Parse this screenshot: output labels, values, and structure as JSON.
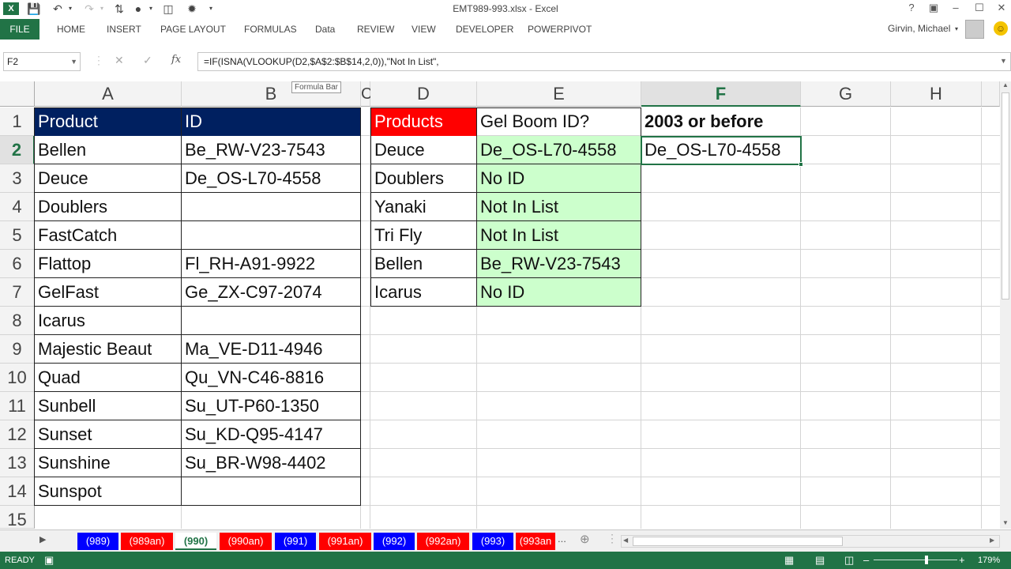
{
  "window": {
    "title": "EMT989-993.xlsx - Excel"
  },
  "ribbon": {
    "file": "FILE",
    "tabs": [
      "HOME",
      "INSERT",
      "PAGE LAYOUT",
      "FORMULAS",
      "Data",
      "REVIEW",
      "VIEW",
      "DEVELOPER",
      "POWERPIVOT"
    ],
    "user": "Girvin, Michael"
  },
  "formula_bar": {
    "name_box": "F2",
    "formula": "=IF(ISNA(VLOOKUP(D2,$A$2:$B$14,2,0)),\"Not In List\",",
    "tooltip": "Formula Bar",
    "fx": "fx"
  },
  "grid": {
    "columns": [
      "A",
      "B",
      "C",
      "D",
      "E",
      "F",
      "G",
      "H"
    ],
    "rows": [
      "1",
      "2",
      "3",
      "4",
      "5",
      "6",
      "7",
      "8",
      "9",
      "10",
      "11",
      "12",
      "13",
      "14",
      "15"
    ],
    "left_table": {
      "headers": [
        "Product",
        "ID"
      ],
      "rows": [
        [
          "Bellen",
          "Be_RW-V23-7543"
        ],
        [
          "Deuce",
          "De_OS-L70-4558"
        ],
        [
          "Doublers",
          ""
        ],
        [
          "FastCatch",
          ""
        ],
        [
          "Flattop",
          "Fl_RH-A91-9922"
        ],
        [
          "GelFast",
          "Ge_ZX-C97-2074"
        ],
        [
          "Icarus",
          ""
        ],
        [
          "Majestic Beaut",
          "Ma_VE-D11-4946"
        ],
        [
          "Quad",
          "Qu_VN-C46-8816"
        ],
        [
          "Sunbell",
          "Su_UT-P60-1350"
        ],
        [
          "Sunset",
          "Su_KD-Q95-4147"
        ],
        [
          "Sunshine",
          "Su_BR-W98-4402"
        ],
        [
          "Sunspot",
          ""
        ]
      ]
    },
    "right_table": {
      "headers": [
        "Products",
        "Gel Boom ID?"
      ],
      "rows": [
        [
          "Deuce",
          "De_OS-L70-4558"
        ],
        [
          "Doublers",
          "No ID"
        ],
        [
          "Yanaki",
          "Not In List"
        ],
        [
          "Tri Fly",
          "Not In List"
        ],
        [
          "Bellen",
          "Be_RW-V23-7543"
        ],
        [
          "Icarus",
          "No ID"
        ]
      ]
    },
    "f1": "2003 or before",
    "f2": "De_OS-L70-4558"
  },
  "sheet_tabs": [
    {
      "label": "(989)",
      "color": "#0000ff"
    },
    {
      "label": "(989an)",
      "color": "#ff0000"
    },
    {
      "label": "(990)",
      "color": "#0000ff"
    },
    {
      "label": "(990an)",
      "color": "#ff0000"
    },
    {
      "label": "(991)",
      "color": "#0000ff"
    },
    {
      "label": "(991an)",
      "color": "#ff0000"
    },
    {
      "label": "(992)",
      "color": "#0000ff"
    },
    {
      "label": "(992an)",
      "color": "#ff0000"
    },
    {
      "label": "(993)",
      "color": "#0000ff"
    },
    {
      "label": "(993an",
      "color": "#ff0000"
    }
  ],
  "more_tabs": "...",
  "status": {
    "mode": "READY",
    "zoom": "179%"
  },
  "colors": {
    "accent": "#217346",
    "header_navy": "#002060",
    "header_red": "#ff0000",
    "green_fill": "#ccffcc"
  }
}
